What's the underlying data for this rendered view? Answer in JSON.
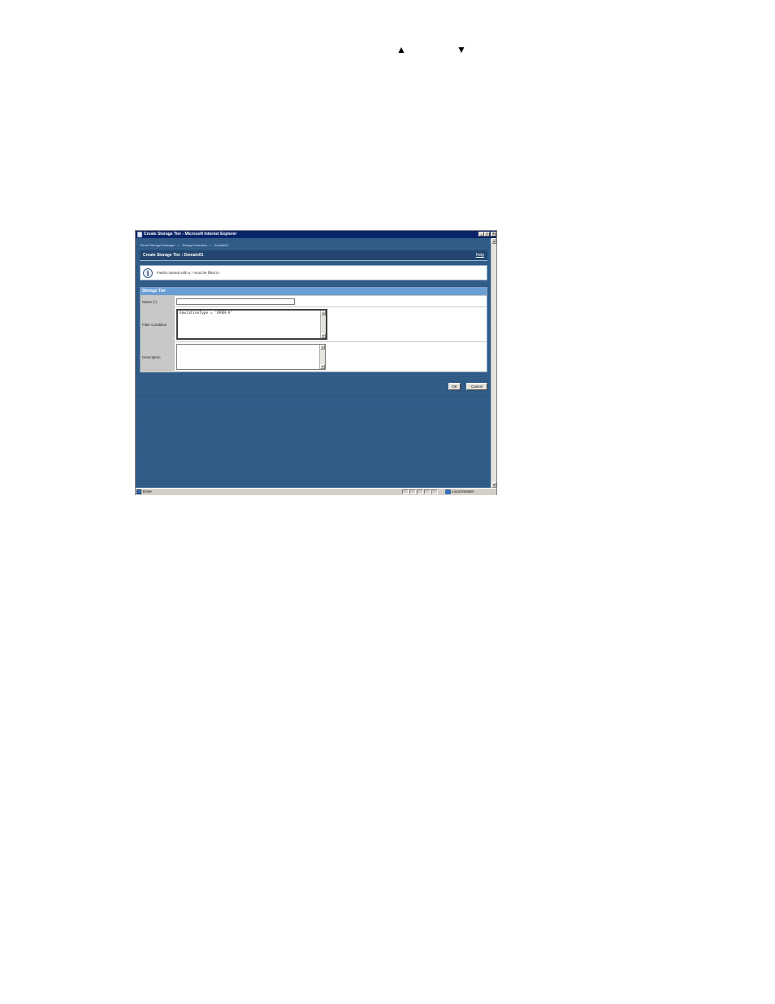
{
  "page_arrows": {
    "up": "▲",
    "down": "▼"
  },
  "window": {
    "title": "Create Storage Tier - Microsoft Internet Explorer",
    "controls": {
      "minimize": "_",
      "maximize": "□",
      "close": "×"
    }
  },
  "breadcrumb": [
    "Tiered Storage Manager",
    ">",
    "Storage Domains",
    ">",
    "Domain01"
  ],
  "header": {
    "title": "Create Storage Tier : Domain01",
    "help": "Help"
  },
  "info": {
    "message": "Fields marked with a * must be filled in."
  },
  "form": {
    "section_title": "Storage Tier",
    "name_label": "Name (*)",
    "name_value": "",
    "filter_label": "Filter Condition",
    "filter_value": "EmulationType = 'OPEN-V'",
    "description_label": "Description",
    "description_value": ""
  },
  "buttons": {
    "ok": "OK",
    "cancel": "Cancel"
  },
  "statusbar": {
    "status": "Done",
    "zone": "Local intranet"
  },
  "colors": {
    "titlebar": "#0a246a",
    "content_bg": "#2e5a85",
    "section_header": "#6b9fd4"
  }
}
